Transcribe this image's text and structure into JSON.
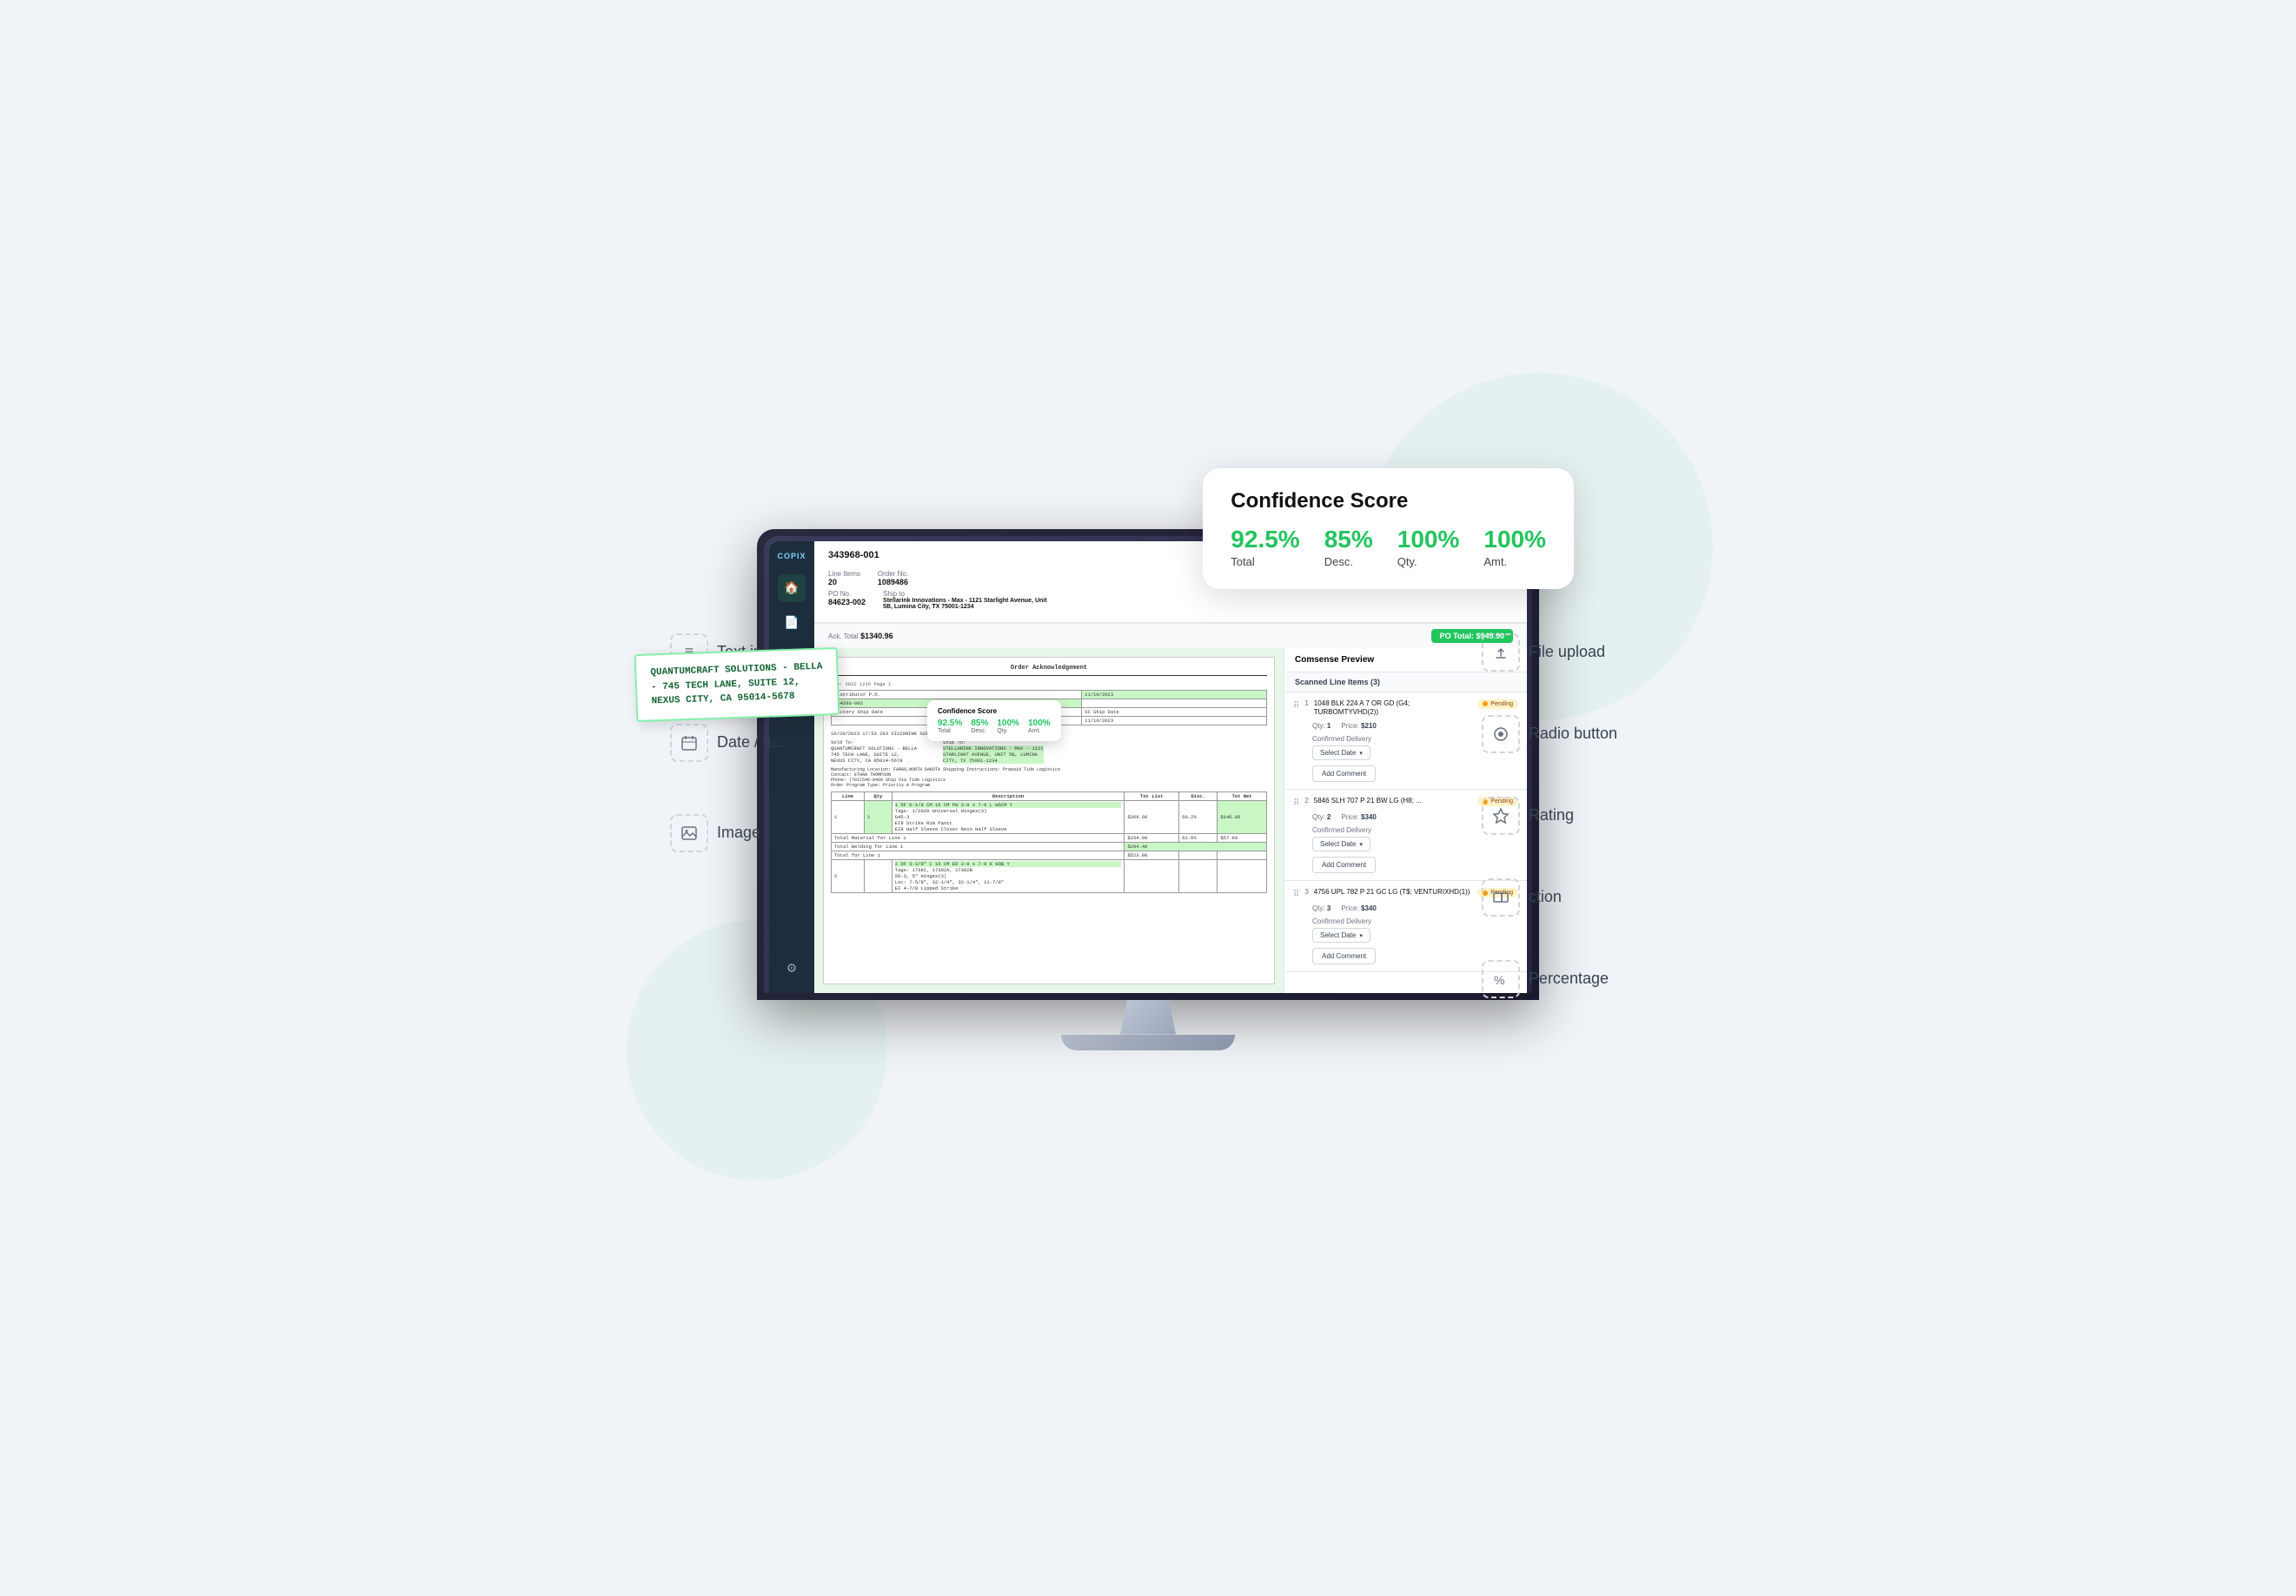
{
  "confidence_card": {
    "title": "Confidence Score",
    "scores": [
      {
        "value": "92.5%",
        "label": "Total"
      },
      {
        "value": "85%",
        "label": "Desc."
      },
      {
        "value": "100%",
        "label": "Qty."
      },
      {
        "value": "100%",
        "label": "Amt."
      }
    ]
  },
  "document": {
    "order_number_label": "343968-001",
    "ship_date_label": "Ship Date",
    "ship_date_value": "11/10/2023",
    "order_no_label": "Order No.",
    "order_no_value": "1089486",
    "line_items_label": "Line Items",
    "line_items_value": "20",
    "po_no_label": "PO No.",
    "po_no_value": "84623-002",
    "ship_to_label": "Ship to",
    "ship_to_value": "Stellarink Innovations - Max - 1121 Starlight Avenue, Unit 5B, Lumina City, TX 75001-1234",
    "sold_to_label": "Sold to",
    "sold_to_value": "QuantumCraft Solutions - Bella - 745 Tech Lane, Suite 12, Nexus City, CA 95014-5678",
    "ack_total_label": "Ack. Total",
    "ack_total_value": "$1340.96",
    "po_total_label": "PO Total:",
    "po_total_value": "$949.90"
  },
  "preview": {
    "header": "Comsense Preview",
    "scanned_label": "Scanned Line Items (3)",
    "items": [
      {
        "number": "1",
        "desc": "1048 BLK 224 A 7 OR GD (G4; TURBOMTYVHD(2))",
        "status": "Pending",
        "qty_label": "Qty:",
        "qty_value": "1",
        "price_label": "Price:",
        "price_value": "$210",
        "confirmed_delivery": "Confirmed Delivery",
        "select_date": "Select Date",
        "add_comment": "Add Comment"
      },
      {
        "number": "2",
        "desc": "5846 SLH 707 P 21 BW LG (H8; ...",
        "status": "Pending",
        "qty_label": "Qty:",
        "qty_value": "2",
        "price_label": "Price:",
        "price_value": "$340",
        "confirmed_delivery": "Confirmed Delivery",
        "select_date": "Select Date",
        "add_comment": "Add Comment"
      },
      {
        "number": "3",
        "desc": "4756 UPL 782 P 21 GC LG (T$; VENTURIXHD(1))",
        "status": "Pending",
        "qty_label": "Qty:",
        "qty_value": "3",
        "price_label": "Price:",
        "price_value": "$340",
        "confirmed_delivery": "Confirmed Delivery",
        "select_date": "Select Date",
        "add_comment": "Add Comment"
      }
    ]
  },
  "floating_doc": {
    "line1": "QUANTUMCRAFT SOLUTIONS - BELLA",
    "line2": "- 745 TECH LANE, SUITE 12,",
    "line3": "NEXUS CITY, CA 95014-5678"
  },
  "features_left": [
    {
      "icon": "≡",
      "label": "Text input"
    },
    {
      "icon": "📅",
      "label": "Date / ti..."
    },
    {
      "icon": "🖼",
      "label": "Image"
    }
  ],
  "features_right": [
    {
      "icon": "☁",
      "label": "File upload"
    },
    {
      "icon": "⊙",
      "label": "Radio button"
    },
    {
      "icon": "★",
      "label": "Rating"
    },
    {
      "icon": "◧",
      "label": "ction"
    },
    {
      "icon": "%",
      "label": "Percentage"
    }
  ],
  "inner_confidence": {
    "title": "Confidence Score",
    "scores": [
      {
        "value": "92.5%",
        "label": "Total"
      },
      {
        "value": "85%",
        "label": "Desc."
      },
      {
        "value": "100%",
        "label": "Qty."
      },
      {
        "value": "100%",
        "label": "Amt."
      }
    ]
  },
  "sidebar": {
    "brand": "COPIX",
    "icons": [
      "🏠",
      "📄",
      "📋",
      "⚙"
    ]
  }
}
